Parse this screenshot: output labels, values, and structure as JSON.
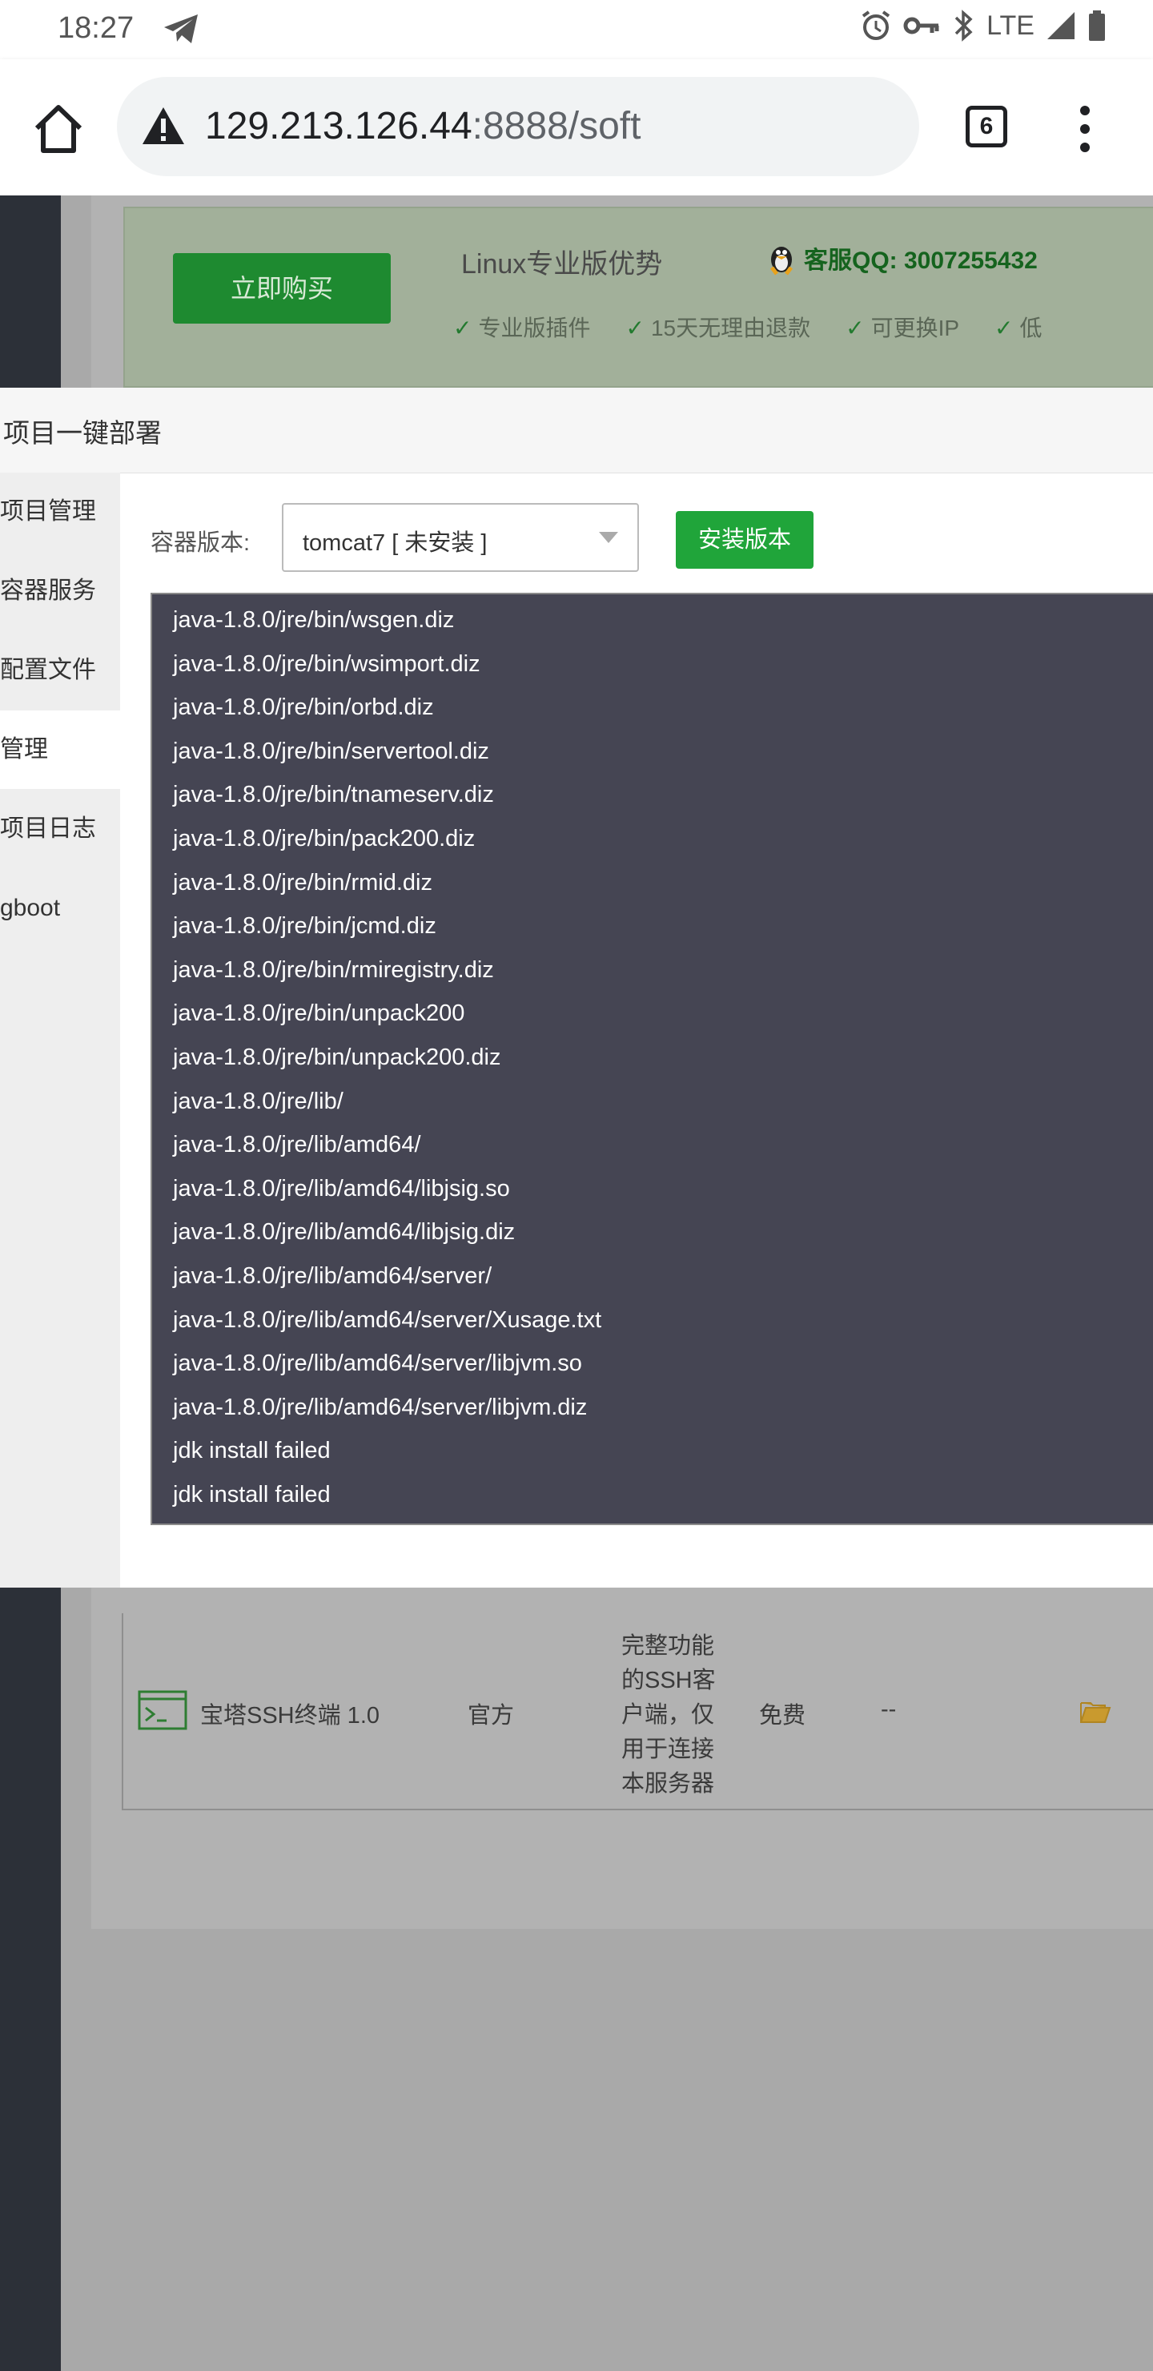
{
  "status_bar": {
    "time": "18:27",
    "network": "LTE",
    "icons": [
      "telegram-icon",
      "alarm-icon",
      "vpn-key-icon",
      "bluetooth-icon",
      "signal-icon",
      "battery-icon"
    ]
  },
  "browser": {
    "url_host": "129.213.126.44",
    "url_rest": ":8888/soft",
    "tab_count": "6",
    "icons": [
      "home-icon",
      "not-secure-warning-icon",
      "overflow-menu-icon"
    ]
  },
  "promo": {
    "buy_label": "立即购买",
    "title": "Linux专业版优势",
    "qq": "客服QQ: 3007255432",
    "features": [
      "专业版插件",
      "15天无理由退款",
      "可更换IP",
      "低"
    ]
  },
  "modal": {
    "title": "项目一键部署",
    "nav": [
      {
        "label": "项目管理",
        "active": false
      },
      {
        "label": "容器服务",
        "active": false
      },
      {
        "label": "配置文件",
        "active": false
      },
      {
        "label": "管理",
        "active": true
      },
      {
        "label": "项目日志",
        "active": false
      },
      {
        "label": "gboot",
        "active": false
      }
    ],
    "version_label": "容器版本:",
    "version_selected": "tomcat7 [ 未安装 ]",
    "install_label": "安装版本",
    "log_lines": [
      "java-1.8.0/jre/bin/wsgen.diz",
      "java-1.8.0/jre/bin/wsimport.diz",
      "java-1.8.0/jre/bin/orbd.diz",
      "java-1.8.0/jre/bin/servertool.diz",
      "java-1.8.0/jre/bin/tnameserv.diz",
      "java-1.8.0/jre/bin/pack200.diz",
      "java-1.8.0/jre/bin/rmid.diz",
      "java-1.8.0/jre/bin/jcmd.diz",
      "java-1.8.0/jre/bin/rmiregistry.diz",
      "java-1.8.0/jre/bin/unpack200",
      "java-1.8.0/jre/bin/unpack200.diz",
      "java-1.8.0/jre/lib/",
      "java-1.8.0/jre/lib/amd64/",
      "java-1.8.0/jre/lib/amd64/libjsig.so",
      "java-1.8.0/jre/lib/amd64/libjsig.diz",
      "java-1.8.0/jre/lib/amd64/server/",
      "java-1.8.0/jre/lib/amd64/server/Xusage.txt",
      "java-1.8.0/jre/lib/amd64/server/libjvm.so",
      "java-1.8.0/jre/lib/amd64/server/libjvm.diz",
      "jdk install failed",
      "jdk install failed"
    ]
  },
  "table_row": {
    "name": "宝塔SSH终端 1.0",
    "developer": "官方",
    "description_lines": [
      "完整功能",
      "的SSH客",
      "户端，仅",
      "用于连接",
      "本服务器"
    ],
    "price": "免费",
    "expire": "--"
  }
}
